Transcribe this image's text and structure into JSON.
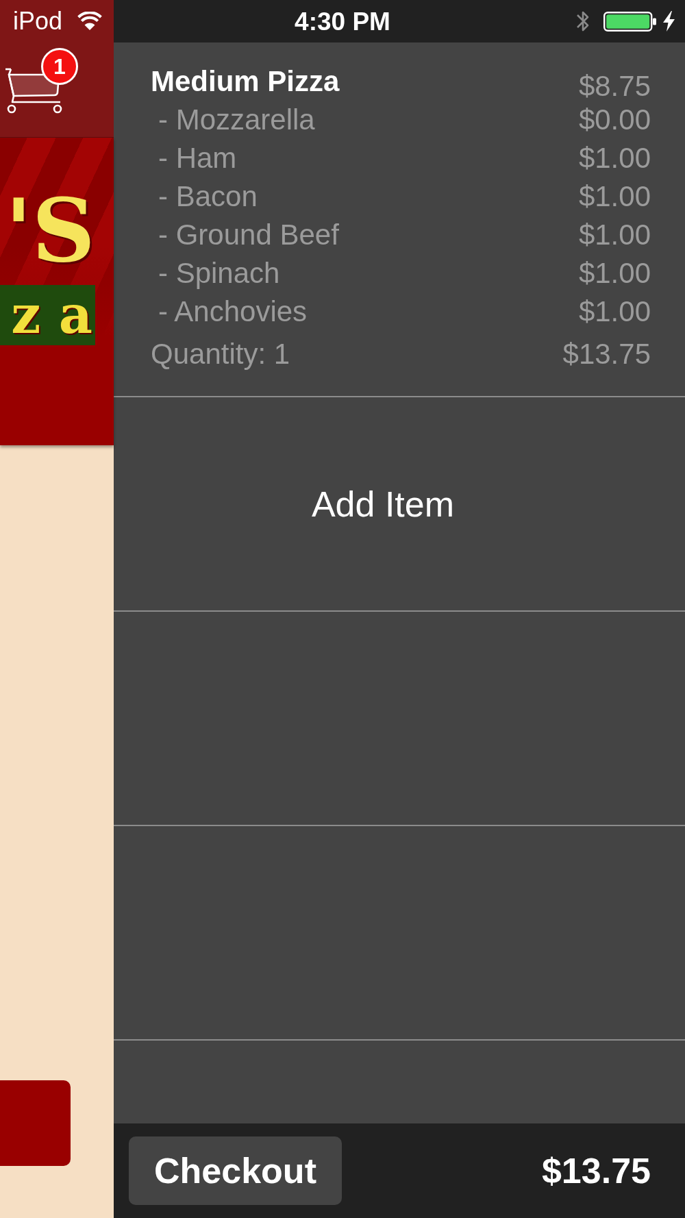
{
  "status_bar": {
    "carrier": "iPod",
    "time": "4:30 PM"
  },
  "side_panel": {
    "cart": {
      "badge": "1"
    },
    "logo": {
      "title": "'S",
      "subtitle": "z a"
    }
  },
  "order": {
    "items": [
      {
        "name": "Medium Pizza",
        "price": "$8.75",
        "toppings": [
          {
            "name": "- Mozzarella",
            "price": "$0.00"
          },
          {
            "name": "- Ham",
            "price": "$1.00"
          },
          {
            "name": "- Bacon",
            "price": "$1.00"
          },
          {
            "name": "- Ground Beef",
            "price": "$1.00"
          },
          {
            "name": "- Spinach",
            "price": "$1.00"
          },
          {
            "name": "- Anchovies",
            "price": "$1.00"
          }
        ],
        "quantity": "Quantity: 1",
        "total": "$13.75"
      }
    ],
    "add_item": "Add Item"
  },
  "checkout_bar": {
    "button": "Checkout",
    "total": "$13.75"
  }
}
